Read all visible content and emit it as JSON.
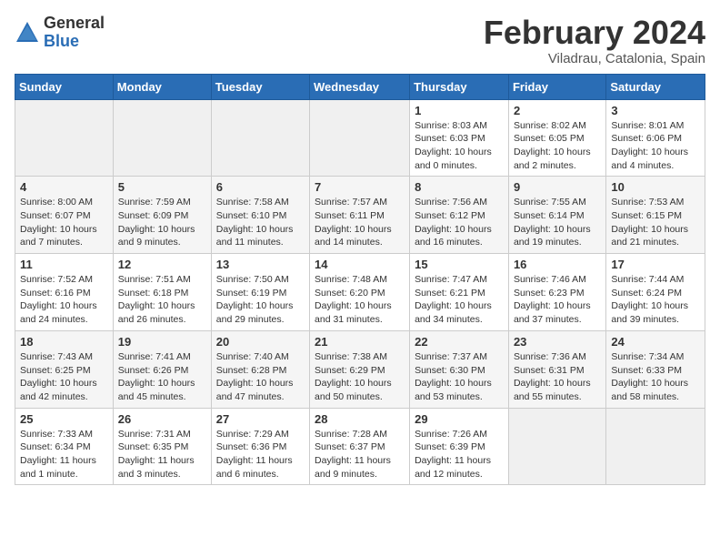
{
  "header": {
    "logo_general": "General",
    "logo_blue": "Blue",
    "month_title": "February 2024",
    "location": "Viladrau, Catalonia, Spain"
  },
  "days_of_week": [
    "Sunday",
    "Monday",
    "Tuesday",
    "Wednesday",
    "Thursday",
    "Friday",
    "Saturday"
  ],
  "weeks": [
    [
      {
        "day": "",
        "info": ""
      },
      {
        "day": "",
        "info": ""
      },
      {
        "day": "",
        "info": ""
      },
      {
        "day": "",
        "info": ""
      },
      {
        "day": "1",
        "info": "Sunrise: 8:03 AM\nSunset: 6:03 PM\nDaylight: 10 hours and 0 minutes."
      },
      {
        "day": "2",
        "info": "Sunrise: 8:02 AM\nSunset: 6:05 PM\nDaylight: 10 hours and 2 minutes."
      },
      {
        "day": "3",
        "info": "Sunrise: 8:01 AM\nSunset: 6:06 PM\nDaylight: 10 hours and 4 minutes."
      }
    ],
    [
      {
        "day": "4",
        "info": "Sunrise: 8:00 AM\nSunset: 6:07 PM\nDaylight: 10 hours and 7 minutes."
      },
      {
        "day": "5",
        "info": "Sunrise: 7:59 AM\nSunset: 6:09 PM\nDaylight: 10 hours and 9 minutes."
      },
      {
        "day": "6",
        "info": "Sunrise: 7:58 AM\nSunset: 6:10 PM\nDaylight: 10 hours and 11 minutes."
      },
      {
        "day": "7",
        "info": "Sunrise: 7:57 AM\nSunset: 6:11 PM\nDaylight: 10 hours and 14 minutes."
      },
      {
        "day": "8",
        "info": "Sunrise: 7:56 AM\nSunset: 6:12 PM\nDaylight: 10 hours and 16 minutes."
      },
      {
        "day": "9",
        "info": "Sunrise: 7:55 AM\nSunset: 6:14 PM\nDaylight: 10 hours and 19 minutes."
      },
      {
        "day": "10",
        "info": "Sunrise: 7:53 AM\nSunset: 6:15 PM\nDaylight: 10 hours and 21 minutes."
      }
    ],
    [
      {
        "day": "11",
        "info": "Sunrise: 7:52 AM\nSunset: 6:16 PM\nDaylight: 10 hours and 24 minutes."
      },
      {
        "day": "12",
        "info": "Sunrise: 7:51 AM\nSunset: 6:18 PM\nDaylight: 10 hours and 26 minutes."
      },
      {
        "day": "13",
        "info": "Sunrise: 7:50 AM\nSunset: 6:19 PM\nDaylight: 10 hours and 29 minutes."
      },
      {
        "day": "14",
        "info": "Sunrise: 7:48 AM\nSunset: 6:20 PM\nDaylight: 10 hours and 31 minutes."
      },
      {
        "day": "15",
        "info": "Sunrise: 7:47 AM\nSunset: 6:21 PM\nDaylight: 10 hours and 34 minutes."
      },
      {
        "day": "16",
        "info": "Sunrise: 7:46 AM\nSunset: 6:23 PM\nDaylight: 10 hours and 37 minutes."
      },
      {
        "day": "17",
        "info": "Sunrise: 7:44 AM\nSunset: 6:24 PM\nDaylight: 10 hours and 39 minutes."
      }
    ],
    [
      {
        "day": "18",
        "info": "Sunrise: 7:43 AM\nSunset: 6:25 PM\nDaylight: 10 hours and 42 minutes."
      },
      {
        "day": "19",
        "info": "Sunrise: 7:41 AM\nSunset: 6:26 PM\nDaylight: 10 hours and 45 minutes."
      },
      {
        "day": "20",
        "info": "Sunrise: 7:40 AM\nSunset: 6:28 PM\nDaylight: 10 hours and 47 minutes."
      },
      {
        "day": "21",
        "info": "Sunrise: 7:38 AM\nSunset: 6:29 PM\nDaylight: 10 hours and 50 minutes."
      },
      {
        "day": "22",
        "info": "Sunrise: 7:37 AM\nSunset: 6:30 PM\nDaylight: 10 hours and 53 minutes."
      },
      {
        "day": "23",
        "info": "Sunrise: 7:36 AM\nSunset: 6:31 PM\nDaylight: 10 hours and 55 minutes."
      },
      {
        "day": "24",
        "info": "Sunrise: 7:34 AM\nSunset: 6:33 PM\nDaylight: 10 hours and 58 minutes."
      }
    ],
    [
      {
        "day": "25",
        "info": "Sunrise: 7:33 AM\nSunset: 6:34 PM\nDaylight: 11 hours and 1 minute."
      },
      {
        "day": "26",
        "info": "Sunrise: 7:31 AM\nSunset: 6:35 PM\nDaylight: 11 hours and 3 minutes."
      },
      {
        "day": "27",
        "info": "Sunrise: 7:29 AM\nSunset: 6:36 PM\nDaylight: 11 hours and 6 minutes."
      },
      {
        "day": "28",
        "info": "Sunrise: 7:28 AM\nSunset: 6:37 PM\nDaylight: 11 hours and 9 minutes."
      },
      {
        "day": "29",
        "info": "Sunrise: 7:26 AM\nSunset: 6:39 PM\nDaylight: 11 hours and 12 minutes."
      },
      {
        "day": "",
        "info": ""
      },
      {
        "day": "",
        "info": ""
      }
    ]
  ]
}
